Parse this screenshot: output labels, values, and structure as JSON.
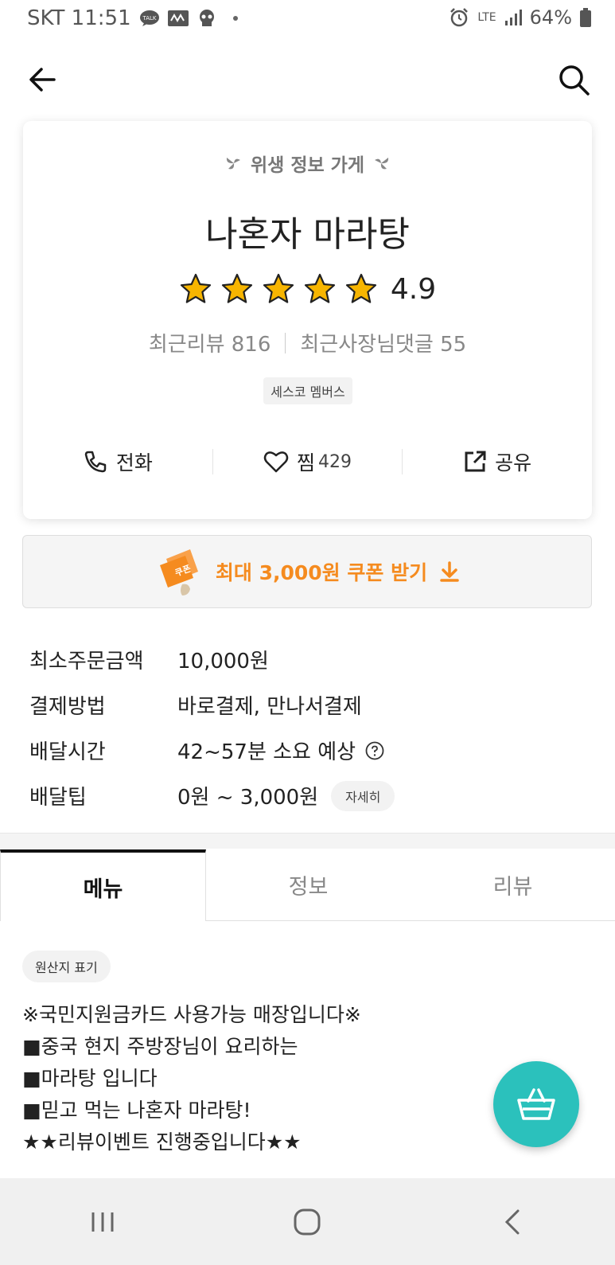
{
  "status_bar": {
    "carrier_time": "SKT 11:51",
    "talk_label": "TALK",
    "network": "LTE",
    "battery": "64%"
  },
  "store": {
    "hygiene_label": "위생 정보 가게",
    "name": "나혼자 마라탕",
    "rating": "4.9",
    "star_count": 5,
    "recent_reviews": "최근리뷰 816",
    "owner_replies": "최근사장님댓글 55",
    "member_badge": "세스코 멤버스"
  },
  "actions": {
    "call": "전화",
    "favorite": "찜",
    "favorite_count": "429",
    "share": "공유"
  },
  "coupon": {
    "label": "최대 3,000원 쿠폰 받기",
    "ticket_text": "쿠폰",
    "accent": "#f58b1f"
  },
  "info": [
    {
      "label": "최소주문금액",
      "value": "10,000원"
    },
    {
      "label": "결제방법",
      "value": "바로결제, 만나서결제"
    },
    {
      "label": "배달시간",
      "value": "42~57분 소요 예상"
    },
    {
      "label": "배달팁",
      "value": "0원 ~ 3,000원",
      "button": "자세히"
    }
  ],
  "tabs": [
    "메뉴",
    "정보",
    "리뷰"
  ],
  "origin_button": "원산지 표기",
  "notice_lines": [
    "※국민지원금카드 사용가능 매장입니다※",
    "■중국 현지 주방장님이 요리하는",
    "■마라탕 입니다",
    "■믿고 먹는 나혼자 마라탕!",
    "★★리뷰이벤트 진행중입니다★★"
  ],
  "colors": {
    "fab": "#2bc1bc",
    "star": "#f7b500"
  }
}
